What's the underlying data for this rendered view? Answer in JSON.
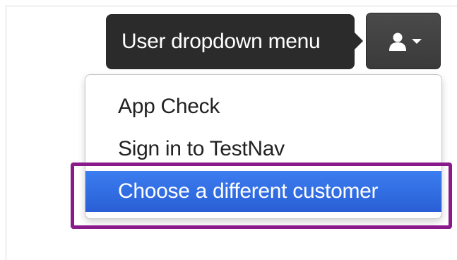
{
  "tooltip": {
    "text": "User dropdown menu"
  },
  "user_button": {
    "icon": "user-icon",
    "caret": "caret-down-icon"
  },
  "dropdown": {
    "items": [
      {
        "label": "App Check"
      },
      {
        "label": "Sign in to TestNav"
      },
      {
        "label": "Choose a different customer",
        "selected": true
      }
    ]
  },
  "colors": {
    "tooltip_bg": "#2b2b2b",
    "button_bg": "#404040",
    "selected_item_bg": "#2f6be3",
    "highlight_border": "#8a1a8a"
  }
}
